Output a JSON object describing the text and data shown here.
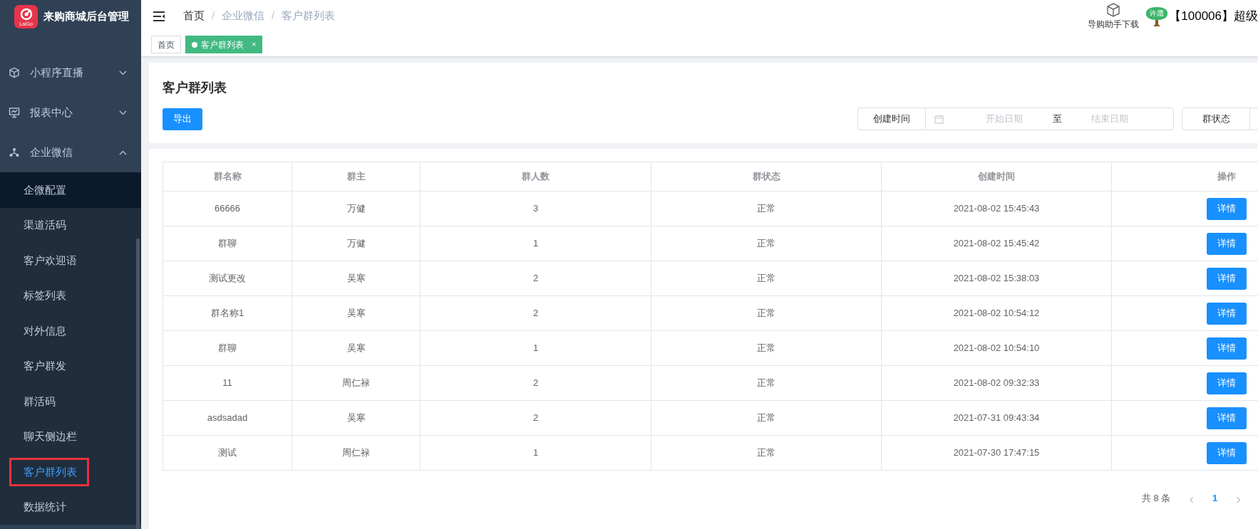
{
  "app": {
    "title": "来购商城后台管理",
    "logo_text": "LaiGo"
  },
  "sidebar": {
    "items": [
      {
        "label": "小程序直播",
        "expanded": false
      },
      {
        "label": "报表中心",
        "expanded": false
      },
      {
        "label": "企业微信",
        "expanded": true,
        "children": [
          {
            "label": "企微配置",
            "selected": false,
            "hovered": true
          },
          {
            "label": "渠道活码",
            "selected": false,
            "hovered": false
          },
          {
            "label": "客户欢迎语",
            "selected": false,
            "hovered": false
          },
          {
            "label": "标签列表",
            "selected": false,
            "hovered": false
          },
          {
            "label": "对外信息",
            "selected": false,
            "hovered": false
          },
          {
            "label": "客户群发",
            "selected": false,
            "hovered": false
          },
          {
            "label": "群活码",
            "selected": false,
            "hovered": false
          },
          {
            "label": "聊天侧边栏",
            "selected": false,
            "hovered": false
          },
          {
            "label": "客户群列表",
            "selected": true,
            "hovered": false
          },
          {
            "label": "数据统计",
            "selected": false,
            "hovered": false
          }
        ]
      }
    ]
  },
  "header": {
    "breadcrumb": [
      "首页",
      "企业微信",
      "客户群列表"
    ],
    "breadcrumb_separator": "/",
    "download": "导购助手下载",
    "avatar_text": "许愿",
    "user": "【100006】超级"
  },
  "tabs": [
    {
      "label": "首页",
      "selected": false
    },
    {
      "label": "客户群列表",
      "selected": true,
      "close": "×"
    }
  ],
  "page": {
    "title": "客户群列表",
    "export_button": "导出",
    "filters": {
      "date_label": "创建时间",
      "start_placeholder": "开始日期",
      "separator": "至",
      "end_placeholder": "结束日期",
      "status_label": "群状态"
    }
  },
  "table": {
    "columns": [
      "群名称",
      "群主",
      "群人数",
      "群状态",
      "创建时间",
      "操作"
    ],
    "rows": [
      {
        "name": "66666",
        "owner": "万健",
        "members": "3",
        "status": "正常",
        "created": "2021-08-02 15:45:43",
        "action": "详情"
      },
      {
        "name": "群聊",
        "owner": "万健",
        "members": "1",
        "status": "正常",
        "created": "2021-08-02 15:45:42",
        "action": "详情"
      },
      {
        "name": "测试更改",
        "owner": "吴寒",
        "members": "2",
        "status": "正常",
        "created": "2021-08-02 15:38:03",
        "action": "详情"
      },
      {
        "name": "群名称1",
        "owner": "吴寒",
        "members": "2",
        "status": "正常",
        "created": "2021-08-02 10:54:12",
        "action": "详情"
      },
      {
        "name": "群聊",
        "owner": "吴寒",
        "members": "1",
        "status": "正常",
        "created": "2021-08-02 10:54:10",
        "action": "详情"
      },
      {
        "name": "11",
        "owner": "周仁禄",
        "members": "2",
        "status": "正常",
        "created": "2021-08-02 09:32:33",
        "action": "详情"
      },
      {
        "name": "asdsadad",
        "owner": "吴寒",
        "members": "2",
        "status": "正常",
        "created": "2021-07-31 09:43:34",
        "action": "详情"
      },
      {
        "name": "测试",
        "owner": "周仁禄",
        "members": "1",
        "status": "正常",
        "created": "2021-07-30 17:47:15",
        "action": "详情"
      }
    ]
  },
  "pagination": {
    "total": "共 8 条",
    "prev": "‹",
    "pages": [
      {
        "label": "1",
        "selected": true
      }
    ],
    "next": "›"
  }
}
